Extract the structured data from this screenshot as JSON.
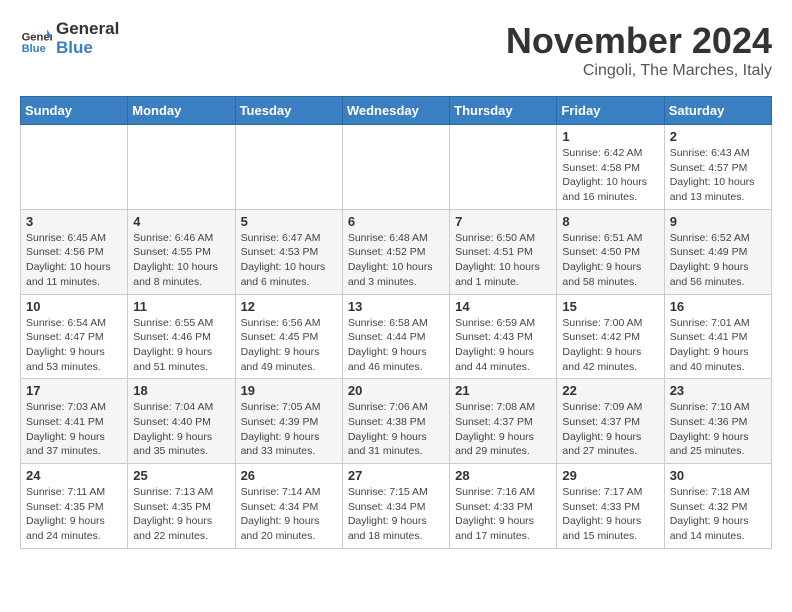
{
  "logo": {
    "text_general": "General",
    "text_blue": "Blue"
  },
  "title": "November 2024",
  "location": "Cingoli, The Marches, Italy",
  "days_of_week": [
    "Sunday",
    "Monday",
    "Tuesday",
    "Wednesday",
    "Thursday",
    "Friday",
    "Saturday"
  ],
  "weeks": [
    [
      {
        "day": "",
        "info": ""
      },
      {
        "day": "",
        "info": ""
      },
      {
        "day": "",
        "info": ""
      },
      {
        "day": "",
        "info": ""
      },
      {
        "day": "",
        "info": ""
      },
      {
        "day": "1",
        "info": "Sunrise: 6:42 AM\nSunset: 4:58 PM\nDaylight: 10 hours and 16 minutes."
      },
      {
        "day": "2",
        "info": "Sunrise: 6:43 AM\nSunset: 4:57 PM\nDaylight: 10 hours and 13 minutes."
      }
    ],
    [
      {
        "day": "3",
        "info": "Sunrise: 6:45 AM\nSunset: 4:56 PM\nDaylight: 10 hours and 11 minutes."
      },
      {
        "day": "4",
        "info": "Sunrise: 6:46 AM\nSunset: 4:55 PM\nDaylight: 10 hours and 8 minutes."
      },
      {
        "day": "5",
        "info": "Sunrise: 6:47 AM\nSunset: 4:53 PM\nDaylight: 10 hours and 6 minutes."
      },
      {
        "day": "6",
        "info": "Sunrise: 6:48 AM\nSunset: 4:52 PM\nDaylight: 10 hours and 3 minutes."
      },
      {
        "day": "7",
        "info": "Sunrise: 6:50 AM\nSunset: 4:51 PM\nDaylight: 10 hours and 1 minute."
      },
      {
        "day": "8",
        "info": "Sunrise: 6:51 AM\nSunset: 4:50 PM\nDaylight: 9 hours and 58 minutes."
      },
      {
        "day": "9",
        "info": "Sunrise: 6:52 AM\nSunset: 4:49 PM\nDaylight: 9 hours and 56 minutes."
      }
    ],
    [
      {
        "day": "10",
        "info": "Sunrise: 6:54 AM\nSunset: 4:47 PM\nDaylight: 9 hours and 53 minutes."
      },
      {
        "day": "11",
        "info": "Sunrise: 6:55 AM\nSunset: 4:46 PM\nDaylight: 9 hours and 51 minutes."
      },
      {
        "day": "12",
        "info": "Sunrise: 6:56 AM\nSunset: 4:45 PM\nDaylight: 9 hours and 49 minutes."
      },
      {
        "day": "13",
        "info": "Sunrise: 6:58 AM\nSunset: 4:44 PM\nDaylight: 9 hours and 46 minutes."
      },
      {
        "day": "14",
        "info": "Sunrise: 6:59 AM\nSunset: 4:43 PM\nDaylight: 9 hours and 44 minutes."
      },
      {
        "day": "15",
        "info": "Sunrise: 7:00 AM\nSunset: 4:42 PM\nDaylight: 9 hours and 42 minutes."
      },
      {
        "day": "16",
        "info": "Sunrise: 7:01 AM\nSunset: 4:41 PM\nDaylight: 9 hours and 40 minutes."
      }
    ],
    [
      {
        "day": "17",
        "info": "Sunrise: 7:03 AM\nSunset: 4:41 PM\nDaylight: 9 hours and 37 minutes."
      },
      {
        "day": "18",
        "info": "Sunrise: 7:04 AM\nSunset: 4:40 PM\nDaylight: 9 hours and 35 minutes."
      },
      {
        "day": "19",
        "info": "Sunrise: 7:05 AM\nSunset: 4:39 PM\nDaylight: 9 hours and 33 minutes."
      },
      {
        "day": "20",
        "info": "Sunrise: 7:06 AM\nSunset: 4:38 PM\nDaylight: 9 hours and 31 minutes."
      },
      {
        "day": "21",
        "info": "Sunrise: 7:08 AM\nSunset: 4:37 PM\nDaylight: 9 hours and 29 minutes."
      },
      {
        "day": "22",
        "info": "Sunrise: 7:09 AM\nSunset: 4:37 PM\nDaylight: 9 hours and 27 minutes."
      },
      {
        "day": "23",
        "info": "Sunrise: 7:10 AM\nSunset: 4:36 PM\nDaylight: 9 hours and 25 minutes."
      }
    ],
    [
      {
        "day": "24",
        "info": "Sunrise: 7:11 AM\nSunset: 4:35 PM\nDaylight: 9 hours and 24 minutes."
      },
      {
        "day": "25",
        "info": "Sunrise: 7:13 AM\nSunset: 4:35 PM\nDaylight: 9 hours and 22 minutes."
      },
      {
        "day": "26",
        "info": "Sunrise: 7:14 AM\nSunset: 4:34 PM\nDaylight: 9 hours and 20 minutes."
      },
      {
        "day": "27",
        "info": "Sunrise: 7:15 AM\nSunset: 4:34 PM\nDaylight: 9 hours and 18 minutes."
      },
      {
        "day": "28",
        "info": "Sunrise: 7:16 AM\nSunset: 4:33 PM\nDaylight: 9 hours and 17 minutes."
      },
      {
        "day": "29",
        "info": "Sunrise: 7:17 AM\nSunset: 4:33 PM\nDaylight: 9 hours and 15 minutes."
      },
      {
        "day": "30",
        "info": "Sunrise: 7:18 AM\nSunset: 4:32 PM\nDaylight: 9 hours and 14 minutes."
      }
    ]
  ]
}
